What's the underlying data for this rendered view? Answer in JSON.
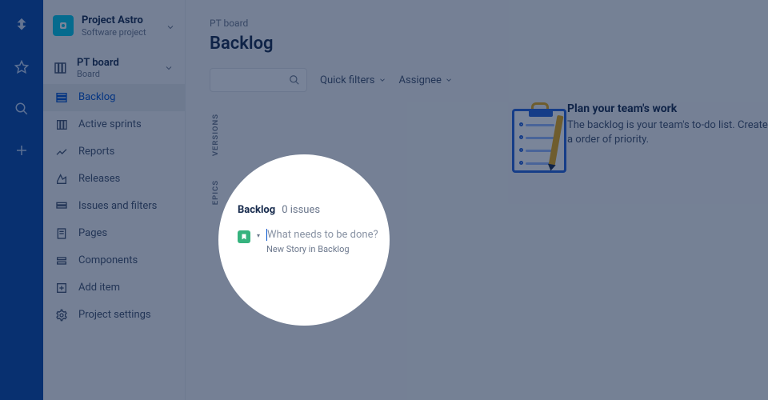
{
  "project": {
    "name": "Project Astro",
    "subtitle": "Software project"
  },
  "boardGroup": {
    "label": "PT board",
    "type": "Board"
  },
  "nav": [
    {
      "label": "Backlog",
      "icon": "backlog",
      "active": true
    },
    {
      "label": "Active sprints",
      "icon": "sprints",
      "active": false
    },
    {
      "label": "Reports",
      "icon": "reports",
      "active": false
    },
    {
      "label": "Releases",
      "icon": "releases",
      "active": false
    },
    {
      "label": "Issues and filters",
      "icon": "issues",
      "active": false
    },
    {
      "label": "Pages",
      "icon": "pages",
      "active": false
    },
    {
      "label": "Components",
      "icon": "components",
      "active": false
    },
    {
      "label": "Add item",
      "icon": "add",
      "active": false
    },
    {
      "label": "Project settings",
      "icon": "settings",
      "active": false
    }
  ],
  "breadcrumb": "PT board",
  "pageTitle": "Backlog",
  "toolbar": {
    "quickFilters": "Quick filters",
    "assignee": "Assignee"
  },
  "verticalTabs": [
    "VERSIONS",
    "EPICS"
  ],
  "emptyState": {
    "title": "Plan your team's work",
    "body": "The backlog is your team's to-do list. Create a order of priority."
  },
  "spotlight": {
    "heading": "Backlog",
    "count": "0 issues",
    "placeholder": "What needs to be done?",
    "caption": "New Story in Backlog"
  }
}
